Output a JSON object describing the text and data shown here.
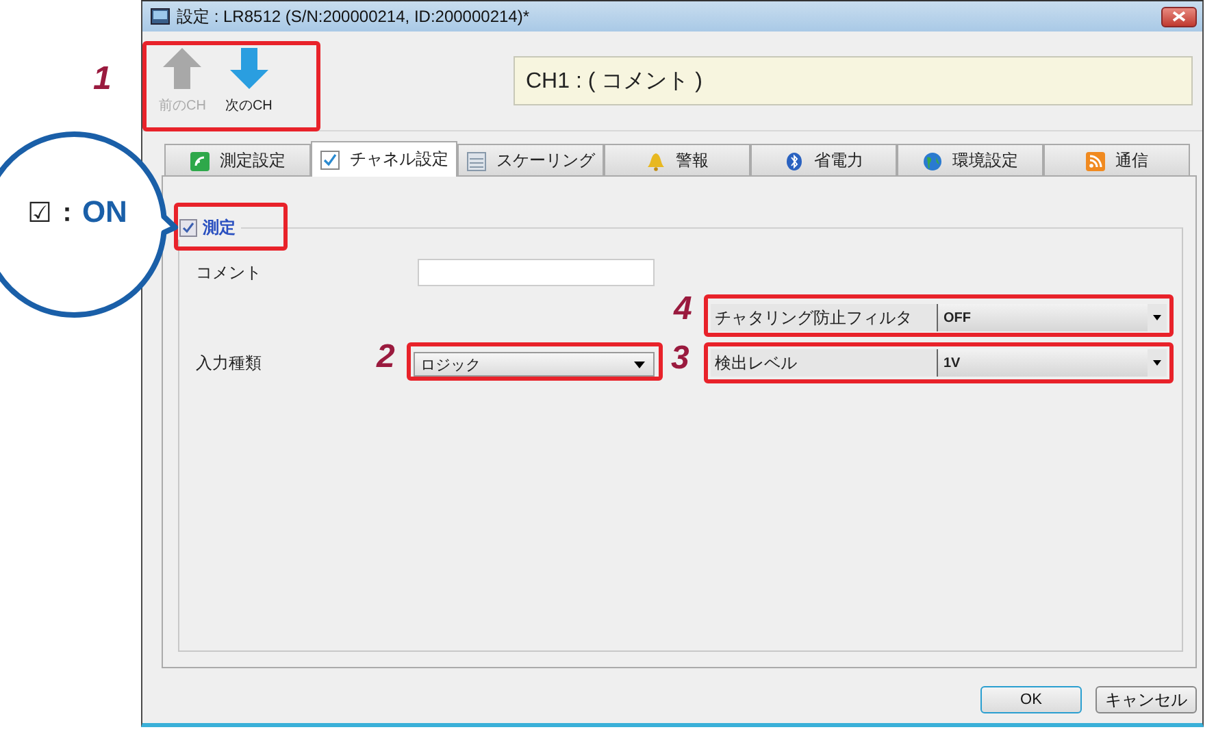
{
  "window": {
    "title": "設定 : LR8512 (S/N:200000214, ID:200000214)*"
  },
  "nav_buttons": [
    {
      "label": "前のCH",
      "kind": "up",
      "disabled": true
    },
    {
      "label": "次のCH",
      "kind": "down",
      "disabled": false
    }
  ],
  "comment_display": "CH1 : ( コメント )",
  "tabs": [
    {
      "label": "測定設定",
      "kind": "measure",
      "selected": false
    },
    {
      "label": "チャネル設定",
      "kind": "channel",
      "selected": true
    },
    {
      "label": "スケーリング",
      "kind": "scaling",
      "selected": false
    },
    {
      "label": "警報",
      "kind": "alarm",
      "selected": false
    },
    {
      "label": "省電力",
      "kind": "power",
      "selected": false
    },
    {
      "label": "環境設定",
      "kind": "environment",
      "selected": false
    },
    {
      "label": "通信",
      "kind": "communication",
      "selected": false
    }
  ],
  "group": {
    "label": "測定",
    "checked": true
  },
  "comment": {
    "label": "コメント"
  },
  "input_type": {
    "label": "入力種類",
    "value": "ロジック"
  },
  "chatter_filter": {
    "label": "チャタリング防止フィルタ",
    "value": "OFF"
  },
  "detect_level": {
    "label": "検出レベル",
    "value": "1V"
  },
  "buttons": [
    {
      "label": "OK",
      "kind": "default"
    },
    {
      "label": "キャンセル",
      "kind": "normal"
    }
  ],
  "callout": {
    "symbol": "☑",
    "colon": "：",
    "text": "ON"
  },
  "markers": [
    {
      "number": "1"
    },
    {
      "number": "2"
    },
    {
      "number": "3"
    },
    {
      "number": "4"
    }
  ]
}
